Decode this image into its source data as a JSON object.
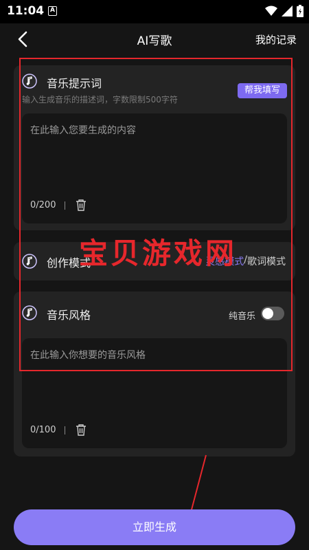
{
  "status": {
    "time": "11:04",
    "a_icon": "A"
  },
  "nav": {
    "title": "AI写歌",
    "records": "我的记录"
  },
  "prompt_card": {
    "title": "音乐提示词",
    "subtitle": "输入生成音乐的描述词，字数限制500字符",
    "help_button": "帮我填写",
    "placeholder": "在此输入您要生成的内容",
    "counter": "0/200"
  },
  "mode_card": {
    "title": "创作模式",
    "option_active": "灵感模式",
    "separator": "/",
    "option_inactive": "歌词模式"
  },
  "style_card": {
    "title": "音乐风格",
    "pure_music_label": "纯音乐",
    "placeholder": "在此输入你想要的音乐风格",
    "counter": "0/100"
  },
  "watermark": "宝贝游戏网",
  "generate_button": "立即生成",
  "colors": {
    "accent": "#8a7cf5",
    "annotation_red": "#e6272c",
    "background": "#151515",
    "card": "#232323"
  }
}
